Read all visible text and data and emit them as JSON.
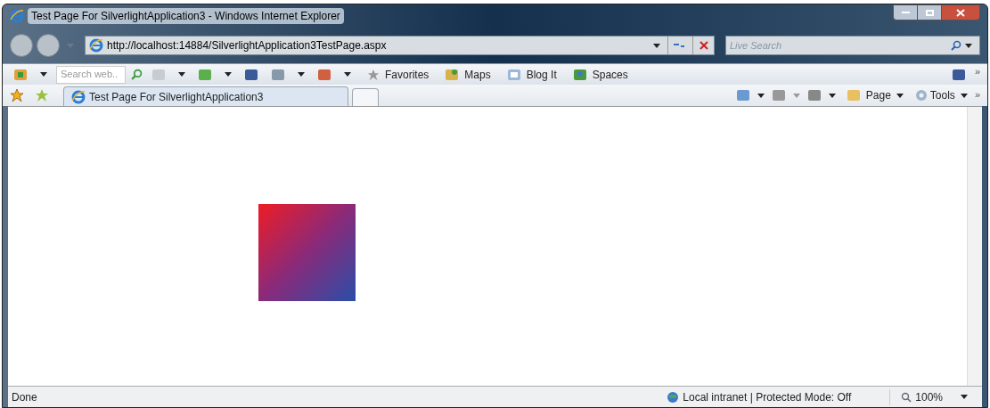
{
  "window": {
    "title": "Test Page For SilverlightApplication3 - Windows Internet Explorer"
  },
  "address_bar": {
    "url": "http://localhost:14884/SilverlightApplication3TestPage.aspx"
  },
  "search": {
    "placeholder": "Live Search"
  },
  "toolbar": {
    "search": {
      "placeholder": "Search web.."
    },
    "items": [
      {
        "label": "Favorites"
      },
      {
        "label": "Maps"
      },
      {
        "label": "Blog It"
      },
      {
        "label": "Spaces"
      }
    ],
    "more": "»"
  },
  "tabs": [
    {
      "label": "Test Page For SilverlightApplication3",
      "selected": true
    }
  ],
  "command_bar": {
    "items": [
      {
        "label": "Page"
      },
      {
        "label": "Tools"
      }
    ],
    "more": "»"
  },
  "status_bar": {
    "text": "Done",
    "zone": "Local intranet | Protected Mode: Off",
    "zoom": "100%"
  }
}
